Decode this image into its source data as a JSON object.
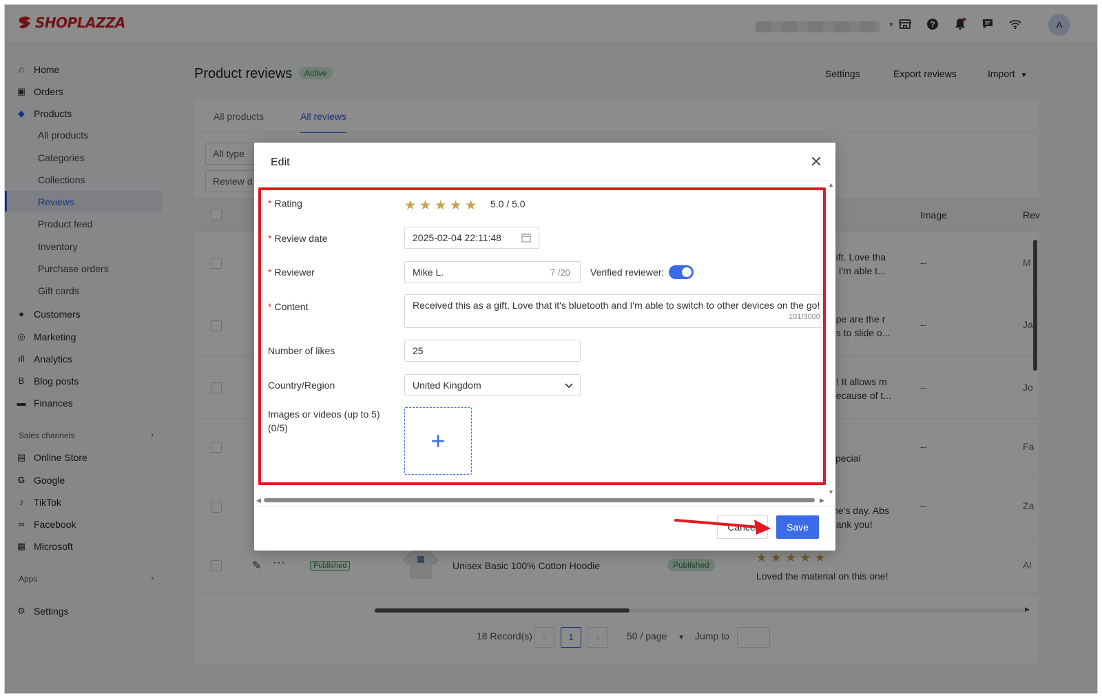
{
  "app": {
    "brand": "SHOPLAZZA",
    "avatar_letter": "A"
  },
  "topbar_icons": [
    "store-icon",
    "help-icon",
    "bell-icon",
    "chat-icon",
    "wifi-icon"
  ],
  "sidebar": {
    "items": [
      {
        "label": "Home",
        "icon": "home-icon"
      },
      {
        "label": "Orders",
        "icon": "orders-icon"
      },
      {
        "label": "Products",
        "icon": "tag-icon"
      }
    ],
    "product_subitems": [
      "All products",
      "Categories",
      "Collections",
      "Reviews",
      "Product feed",
      "Inventory",
      "Purchase orders",
      "Gift cards"
    ],
    "items2": [
      {
        "label": "Customers",
        "icon": "person-icon"
      },
      {
        "label": "Marketing",
        "icon": "marketing-icon"
      },
      {
        "label": "Analytics",
        "icon": "analytics-icon"
      },
      {
        "label": "Blog posts",
        "icon": "blog-icon"
      },
      {
        "label": "Finances",
        "icon": "finances-icon"
      }
    ],
    "sales_channels_label": "Sales channels",
    "channels": [
      {
        "label": "Online Store",
        "icon": "store-icon"
      },
      {
        "label": "Google",
        "icon": "google-icon"
      },
      {
        "label": "TikTok",
        "icon": "tiktok-icon"
      },
      {
        "label": "Facebook",
        "icon": "facebook-icon"
      },
      {
        "label": "Microsoft",
        "icon": "microsoft-icon"
      }
    ],
    "apps_label": "Apps",
    "settings_label": "Settings"
  },
  "page": {
    "title": "Product reviews",
    "status": "Active",
    "actions": {
      "settings": "Settings",
      "export": "Export reviews",
      "import": "Import"
    },
    "tabs": [
      "All products",
      "All reviews"
    ],
    "filters": {
      "type": "All type",
      "review_date": "Review d"
    },
    "columns": {
      "image": "Image",
      "reviewer": "Rev"
    },
    "rows": [
      {
        "content": [
          "gift. Love tha",
          "d I'm able t..."
        ],
        "image": "--",
        "reviewer": "M"
      },
      {
        "content": [
          "ripe are the r",
          "ns to slide o..."
        ],
        "image": "--",
        "reviewer": "Ja"
      },
      {
        "content": [
          "d! It allows m",
          "because of t..."
        ],
        "image": "--",
        "reviewer": "Jo"
      },
      {
        "content": [
          "special"
        ],
        "image": "--",
        "reviewer": "Fa"
      },
      {
        "content": [
          "ine's day. Abs",
          "nank you!"
        ],
        "image": "--",
        "reviewer": "Za"
      }
    ],
    "last_row": {
      "status_tag": "Published",
      "product": "Unisex Basic 100% Cotton Hoodie",
      "product_status": "Published",
      "stars": "★★★★★",
      "content": "Loved the material on this one!",
      "reviewer": "Al"
    },
    "pagination": {
      "records": "18 Record(s)",
      "current": "1",
      "page_size": "50 / page",
      "jump_to": "Jump to"
    }
  },
  "modal": {
    "title": "Edit",
    "rating": {
      "label": "Rating",
      "stars": "★★★★★",
      "value": "5.0 / 5.0"
    },
    "review_date": {
      "label": "Review date",
      "value": "2025-02-04 22:11:48"
    },
    "reviewer": {
      "label": "Reviewer",
      "value": "Mike L.",
      "counter": "7 /20",
      "verified_label": "Verified reviewer:",
      "verified": true
    },
    "content": {
      "label": "Content",
      "value": "Received this as a gift. Love that it's bluetooth and I'm able to switch to other devices on the go!",
      "counter": "101/3000"
    },
    "likes": {
      "label": "Number of likes",
      "value": "25"
    },
    "country": {
      "label": "Country/Region",
      "value": "United Kingdom"
    },
    "media": {
      "label_line1": "Images or videos (up to 5)",
      "label_line2": "(0/5)",
      "plus": "+"
    },
    "buttons": {
      "cancel": "Cancel",
      "save": "Save"
    }
  },
  "colors": {
    "accent": "#3b6be8",
    "annotation": "#e01a22",
    "brand": "#d0222b",
    "star": "#c6a14a"
  }
}
